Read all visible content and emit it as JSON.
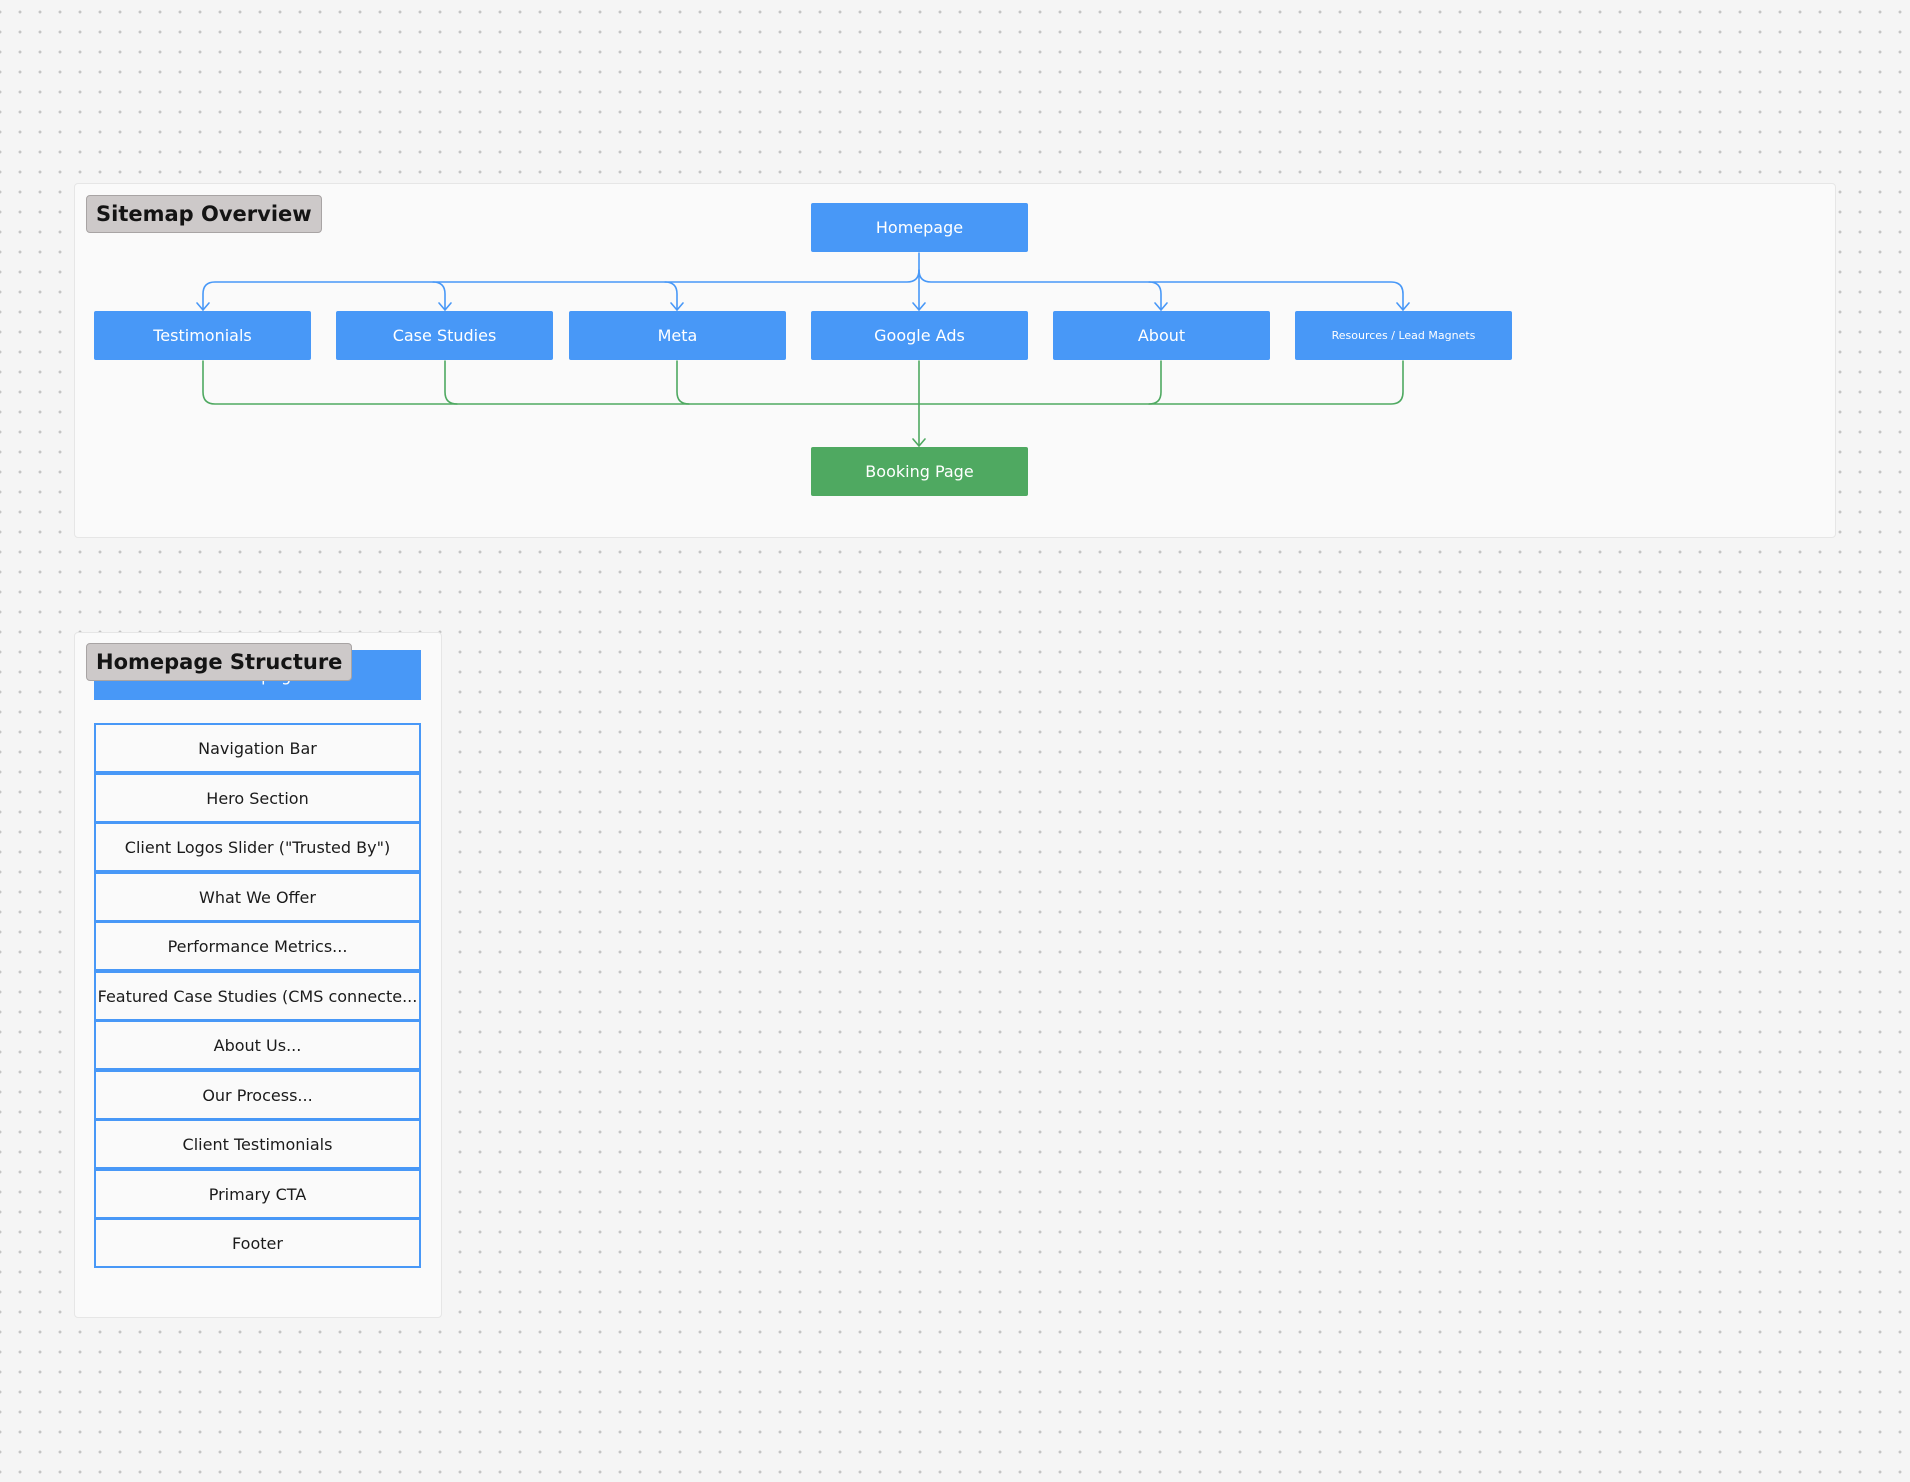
{
  "sitemap": {
    "label": "Sitemap Overview",
    "root": "Homepage",
    "children": [
      "Testimonials",
      "Case Studies",
      "Meta",
      "Google Ads",
      "About",
      "Resources / Lead Magnets"
    ],
    "target": "Booking Page"
  },
  "structure": {
    "label": "Homepage Structure",
    "header": "Homepage",
    "sections": [
      "Navigation Bar",
      "Hero Section",
      "Client Logos Slider (\"Trusted By\")",
      "What We Offer",
      "Performance Metrics...",
      "Featured Case Studies (CMS connecte...",
      "About Us...",
      "Our Process...",
      "Client Testimonials",
      "Primary CTA",
      "Footer"
    ]
  },
  "colors": {
    "node_blue": "#4898f7",
    "node_green": "#4fa961",
    "connector_blue": "#4898f7",
    "connector_green": "#4fa961",
    "label_bg": "#cdc9c9"
  }
}
